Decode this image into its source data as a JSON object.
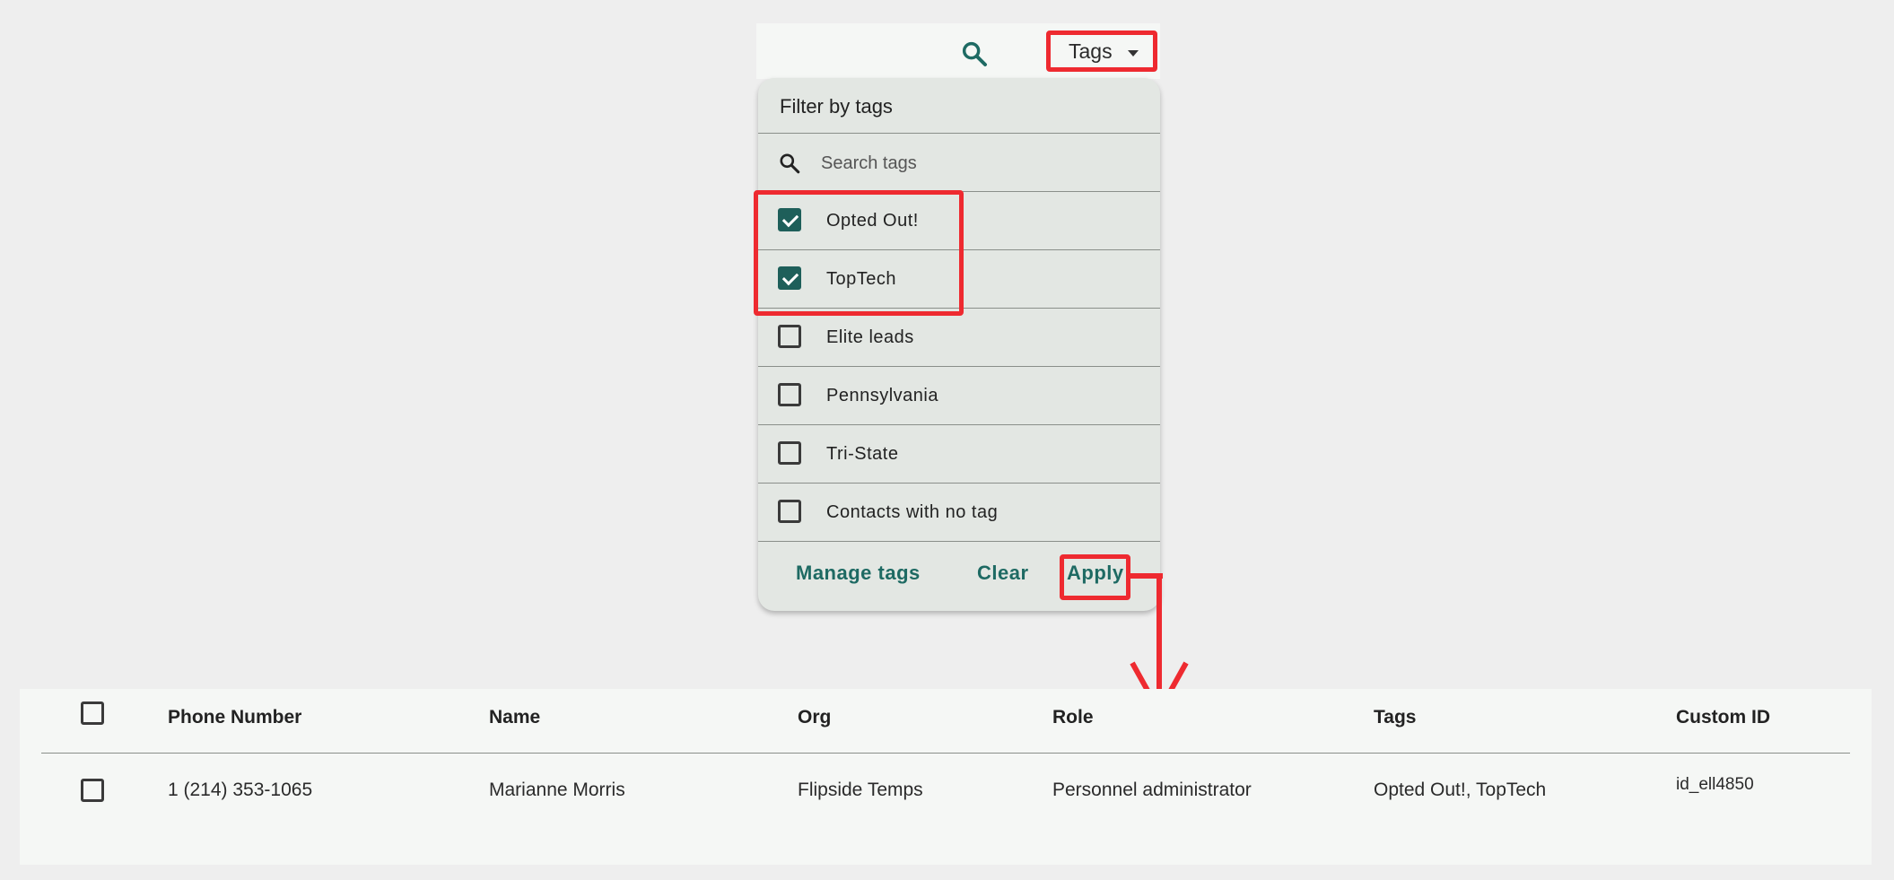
{
  "toolbar": {
    "search_icon": "search-icon",
    "tags_button_label": "Tags"
  },
  "dropdown": {
    "title": "Filter by tags",
    "search_placeholder": "Search tags",
    "items": [
      {
        "label": "Opted Out!",
        "checked": true
      },
      {
        "label": "TopTech",
        "checked": true
      },
      {
        "label": "Elite leads",
        "checked": false
      },
      {
        "label": "Pennsylvania",
        "checked": false
      },
      {
        "label": "Tri-State",
        "checked": false
      },
      {
        "label": "Contacts with no tag",
        "checked": false
      }
    ],
    "manage_label": "Manage tags",
    "clear_label": "Clear",
    "apply_label": "Apply"
  },
  "table": {
    "headers": {
      "phone": "Phone Number",
      "name": "Name",
      "org": "Org",
      "role": "Role",
      "tags": "Tags",
      "custom_id": "Custom ID"
    },
    "rows": [
      {
        "phone": "1 (214) 353-1065",
        "name": "Marianne Morris",
        "org": "Flipside Temps",
        "role": "Personnel administrator",
        "tags": "Opted Out!, TopTech",
        "custom_id": "id_ell4850"
      }
    ]
  },
  "colors": {
    "accent": "#1e6a63",
    "highlight": "#ee2a30",
    "checkbox_checked": "#1e5f5a"
  }
}
